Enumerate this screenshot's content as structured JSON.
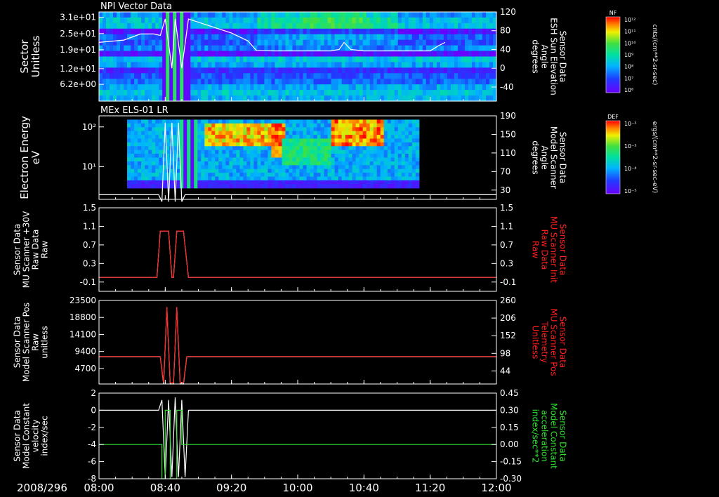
{
  "chart_data": {
    "type": "line",
    "date_label": "2008/296",
    "time_axis": {
      "start": "08:00",
      "end": "12:00",
      "tick_labels": [
        "08:00",
        "08:40",
        "09:20",
        "10:00",
        "10:40",
        "11:20",
        "12:00"
      ]
    },
    "panels": [
      {
        "id": "npi",
        "type": "heatmap",
        "title": "NPI Vector Data",
        "ylabel": [
          "Sector",
          "Unitless"
        ],
        "ylim": [
          0,
          33
        ],
        "yticks": [
          "3.1e+01",
          "2.5e+01",
          "1.9e+01",
          "1.2e+01",
          "6.2e+00"
        ],
        "ytick_values": [
          31,
          25,
          19,
          12,
          6.2
        ],
        "right_ylabel": [
          "Sensor Data",
          "ESH Sun Elevation",
          "Angle",
          "degrees"
        ],
        "right_color": "#ffffff",
        "right_ylim": [
          -70,
          120
        ],
        "right_yticks": [
          "120",
          "80",
          "40",
          "0",
          "-40"
        ],
        "right_ytick_values": [
          120,
          80,
          40,
          0,
          -40
        ],
        "overlay_series": {
          "name": "Sensor Data ESH Sun Elevation Angle",
          "color": "#ffffff",
          "x": [
            "08:00",
            "08:15",
            "08:25",
            "08:33",
            "08:37",
            "08:40",
            "08:44",
            "08:46",
            "08:50",
            "08:54",
            "09:20",
            "09:30",
            "09:35",
            "09:45",
            "10:00",
            "10:20",
            "10:25",
            "10:28",
            "10:32",
            "10:40",
            "11:00",
            "11:10",
            "11:20",
            "11:25",
            "11:29"
          ],
          "y": [
            55,
            60,
            73,
            73,
            70,
            105,
            0,
            105,
            0,
            105,
            75,
            58,
            38,
            37,
            37,
            37,
            40,
            55,
            40,
            37,
            37,
            37,
            37,
            48,
            55
          ]
        },
        "colorbar": {
          "label": "NF",
          "units": "cnts/(cm**2-sr-sec)",
          "ticks": [
            "10¹²",
            "10¹¹",
            "10¹⁰",
            "10⁹",
            "10⁸",
            "10⁷",
            "10⁶"
          ]
        }
      },
      {
        "id": "els",
        "type": "heatmap",
        "title": "MEx ELS-01 LR",
        "ylabel": [
          "Electron Energy",
          "eV"
        ],
        "yscale": "log",
        "ylim": [
          1.5,
          190
        ],
        "yticks": [
          "10²",
          "10¹"
        ],
        "ytick_values": [
          100,
          10
        ],
        "right_ylabel": [
          "Sensor Data",
          "Model Scanner",
          "Angle",
          "degrees"
        ],
        "right_color": "#ffffff",
        "right_ylim": [
          10,
          190
        ],
        "right_yticks": [
          "190",
          "150",
          "110",
          "70",
          "30"
        ],
        "right_ytick_values": [
          190,
          150,
          110,
          70,
          30
        ],
        "overlay_series": {
          "name": "Sensor Data Model Scanner Angle",
          "color": "#ffffff",
          "x": [
            "08:00",
            "08:36",
            "08:38",
            "08:40",
            "08:42",
            "08:44",
            "08:46",
            "08:48",
            "08:50",
            "08:52",
            "12:00"
          ],
          "y": [
            20,
            20,
            5,
            175,
            5,
            175,
            5,
            175,
            5,
            20,
            20
          ]
        },
        "colorbar": {
          "label": "DEF",
          "units": "ergs/(cm**2-sr-sec-eV)",
          "ticks": [
            "10⁻²",
            "10⁻³",
            "10⁻⁴",
            "10⁻⁵"
          ]
        }
      },
      {
        "id": "raw",
        "type": "line",
        "ylabel": [
          "Sensor Data",
          "MU Scanner +30V",
          "Raw Data",
          "Raw"
        ],
        "ylim": [
          -0.3,
          1.5
        ],
        "yticks": [
          "1.5",
          "1.1",
          "0.7",
          "0.3",
          "-0.1"
        ],
        "ytick_values": [
          1.5,
          1.1,
          0.7,
          0.3,
          -0.1
        ],
        "right_ylabel": [
          "Sensor Data",
          "MU Scanner Init",
          "Raw Data",
          "Raw"
        ],
        "right_color": "#ff2020",
        "right_ylim": [
          -0.3,
          1.5
        ],
        "right_yticks": [
          "1.5",
          "1.1",
          "0.7",
          "0.3",
          "-0.1"
        ],
        "right_ytick_values": [
          1.5,
          1.1,
          0.7,
          0.3,
          -0.1
        ],
        "series": [
          {
            "name": "Sensor Data MU Scanner +30V Raw Data",
            "color": "#ffffff",
            "x": [
              "08:00",
              "08:35",
              "08:37",
              "08:42",
              "08:44",
              "08:45",
              "08:47",
              "08:51",
              "08:54",
              "12:00"
            ],
            "y": [
              0,
              0,
              1,
              1,
              0,
              0,
              1,
              1,
              0,
              0
            ]
          },
          {
            "name": "Sensor Data MU Scanner Init Raw Data",
            "color": "#ff2020",
            "x": [
              "08:00",
              "08:35",
              "08:37",
              "08:42",
              "08:44",
              "08:45",
              "08:47",
              "08:51",
              "08:54",
              "12:00"
            ],
            "y": [
              0,
              0,
              1,
              1,
              0,
              0,
              1,
              1,
              0,
              0
            ]
          }
        ]
      },
      {
        "id": "pos",
        "type": "line",
        "ylabel": [
          "Sensor Data",
          "Model Scanner Pos",
          "Raw",
          "unitless"
        ],
        "ylim": [
          400,
          23500
        ],
        "yticks": [
          "23500",
          "18800",
          "14100",
          "9400",
          "4700"
        ],
        "ytick_values": [
          23500,
          18800,
          14100,
          9400,
          4700
        ],
        "right_ylabel": [
          "Sensor Data",
          "MU Scanner Pos",
          "Telemetry",
          "Unitless"
        ],
        "right_color": "#ff2020",
        "right_ylim": [
          4,
          260
        ],
        "right_yticks": [
          "260",
          "206",
          "152",
          "98",
          "44"
        ],
        "right_ytick_values": [
          260,
          206,
          152,
          98,
          44
        ],
        "series": [
          {
            "name": "Sensor Data Model Scanner Pos Raw",
            "color": "#ffffff",
            "x": [
              "08:00",
              "08:37",
              "08:39",
              "08:41",
              "08:43",
              "08:45",
              "08:47",
              "08:49",
              "08:51",
              "08:53",
              "12:00"
            ],
            "y": [
              7900,
              7900,
              400,
              21500,
              400,
              400,
              21500,
              400,
              400,
              7900,
              7900
            ]
          },
          {
            "name": "Sensor Data MU Scanner Pos Telemetry",
            "color": "#ff2020",
            "x": [
              "08:00",
              "08:37",
              "08:39",
              "08:41",
              "08:43",
              "08:45",
              "08:47",
              "08:49",
              "08:51",
              "08:53",
              "12:00"
            ],
            "y": [
              88,
              88,
              8,
              240,
              8,
              8,
              240,
              8,
              8,
              88,
              88
            ]
          }
        ]
      },
      {
        "id": "vel",
        "type": "line",
        "ylabel": [
          "Sensor Data",
          "Model Constant",
          "velocity",
          "index/sec"
        ],
        "ylim": [
          -8,
          2
        ],
        "yticks": [
          "2",
          "0",
          "-2",
          "-4",
          "-6",
          "-8"
        ],
        "ytick_values": [
          2,
          0,
          -2,
          -4,
          -6,
          -8
        ],
        "right_ylabel": [
          "Sensor Data",
          "Model Constant",
          "acceleration",
          "index/sec**2"
        ],
        "right_color": "#30e030",
        "right_ylim": [
          -0.3,
          0.45
        ],
        "right_yticks": [
          "0.45",
          "0.30",
          "0.15",
          "0.00",
          "-0.15",
          "-0.30"
        ],
        "right_ytick_values": [
          0.45,
          0.3,
          0.15,
          0.0,
          -0.15,
          -0.3
        ],
        "series": [
          {
            "name": "Sensor Data Model Constant velocity",
            "color": "#ffffff",
            "x": [
              "08:00",
              "08:36",
              "08:38",
              "08:40",
              "08:42",
              "08:44",
              "08:46",
              "08:48",
              "08:50",
              "08:52",
              "08:54",
              "12:00"
            ],
            "y": [
              0,
              0,
              1.2,
              -7.8,
              1.2,
              -7.8,
              1.5,
              -7.8,
              1.2,
              -7.8,
              0,
              0
            ]
          },
          {
            "name": "Sensor Data Model Constant acceleration",
            "color": "#30e030",
            "x": [
              "08:00",
              "08:38",
              "08:38",
              "08:40",
              "08:40",
              "08:43",
              "08:43",
              "08:47",
              "08:47",
              "08:50",
              "08:50",
              "12:00"
            ],
            "y": [
              0,
              0,
              -0.3,
              -0.3,
              0.3,
              0.3,
              -0.3,
              -0.3,
              0.3,
              0.3,
              0,
              0
            ]
          }
        ]
      }
    ]
  }
}
